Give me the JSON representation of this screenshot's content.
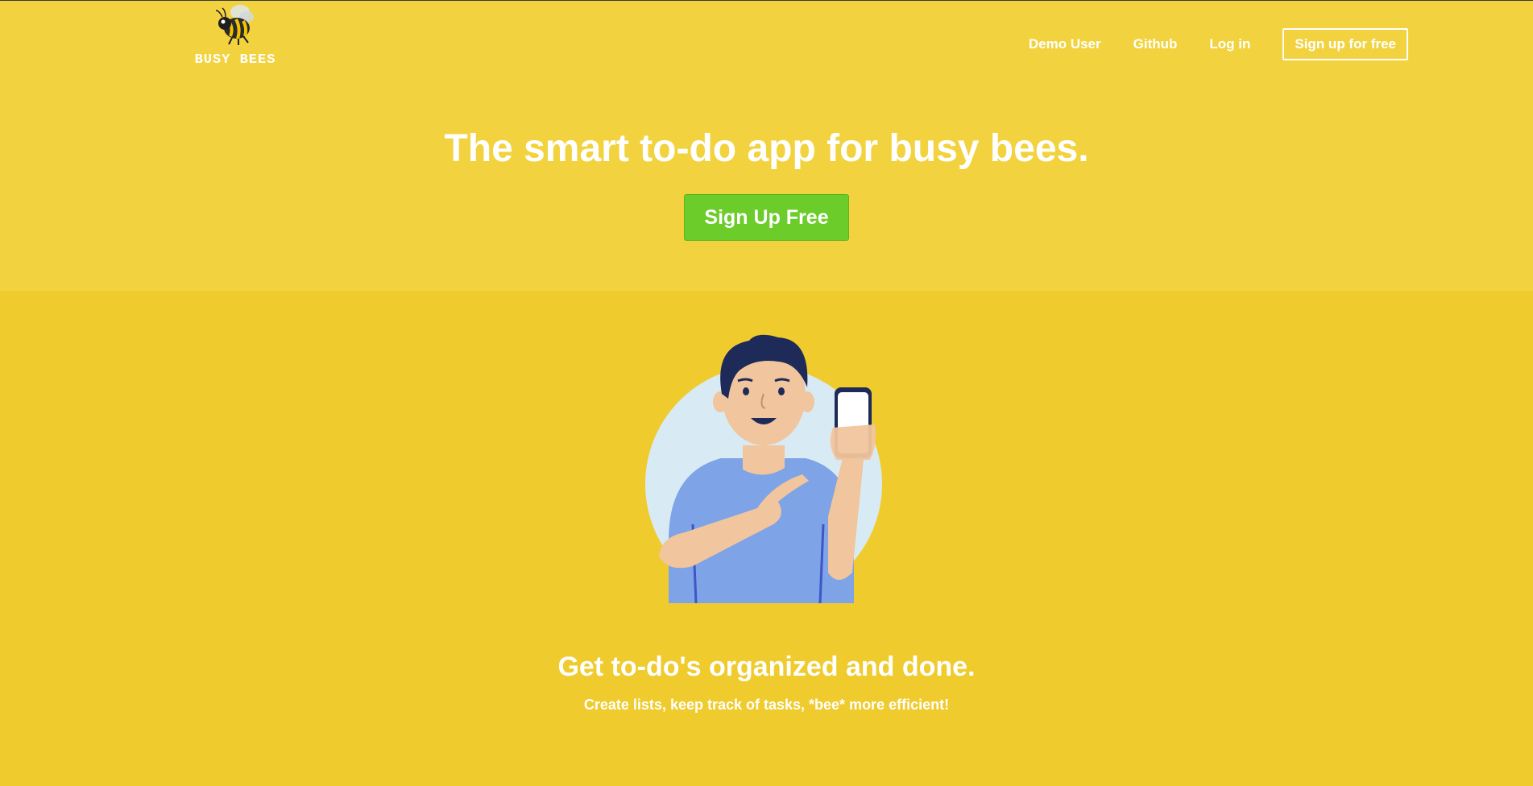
{
  "brand": {
    "name": "BUSY BEES",
    "logo_icon": "bee-icon"
  },
  "nav": {
    "items": [
      {
        "label": "Demo User"
      },
      {
        "label": "Github"
      },
      {
        "label": "Log in"
      }
    ],
    "signup_label": "Sign up for free"
  },
  "hero": {
    "headline": "The smart to-do app for busy bees.",
    "cta_label": "Sign Up Free"
  },
  "features": {
    "illustration": "man-holding-phone-illustration",
    "title": "Get to-do's organized and done.",
    "subtitle": "Create lists, keep track of tasks, *bee* more efficient!"
  },
  "colors": {
    "hero_bg": "#f2d33f",
    "body_bg": "#f0cb2e",
    "cta": "#6bcc2a",
    "text": "#ffffff"
  }
}
